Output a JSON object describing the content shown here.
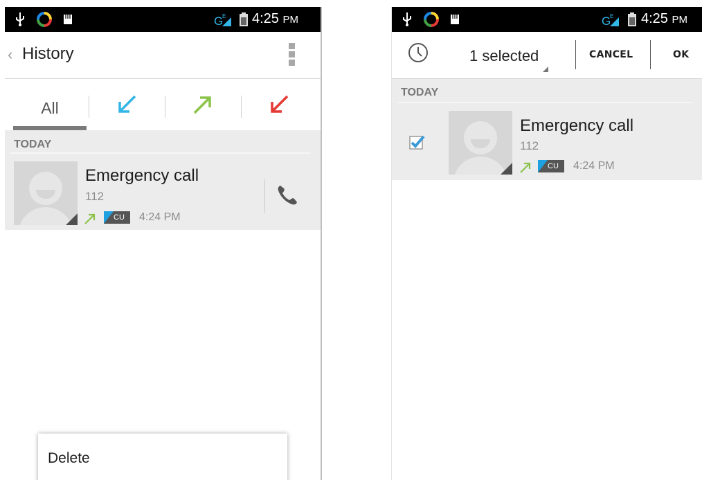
{
  "status_bar": {
    "time": "4:25",
    "ampm": "PM",
    "icons": [
      "usb-icon",
      "app-notification-icon",
      "sd-card-icon",
      "network-signal-icon",
      "battery-icon"
    ]
  },
  "left_screen": {
    "action_bar": {
      "back_icon": "‹",
      "title": "History",
      "overflow_icon": "overflow-menu-icon"
    },
    "tabs": [
      {
        "label": "All",
        "selected": true
      },
      {
        "icon": "incoming-call-icon",
        "color": "#33b5e5"
      },
      {
        "icon": "outgoing-call-icon",
        "color": "#8bc34a"
      },
      {
        "icon": "missed-call-icon",
        "color": "#e53935"
      }
    ],
    "section_header": "TODAY",
    "entry": {
      "name": "Emergency call",
      "number": "112",
      "call_type_icon": "outgoing-call-icon",
      "sim_label": "CU",
      "time": "4:24 PM",
      "call_icon": "phone-icon"
    },
    "popup_menu": {
      "items": [
        "Delete"
      ]
    }
  },
  "right_screen": {
    "action_bar": {
      "history_icon": "clock-icon",
      "selected_label": "1 selected",
      "cancel_label": "CANCEL",
      "ok_label": "OK"
    },
    "section_header": "TODAY",
    "entry": {
      "checked": true,
      "name": "Emergency call",
      "number": "112",
      "call_type_icon": "outgoing-call-icon",
      "sim_label": "CU",
      "time": "4:24 PM"
    }
  },
  "colors": {
    "incoming": "#33b5e5",
    "outgoing": "#8bc34a",
    "missed": "#e53935",
    "checkbox": "#3d9bd8",
    "sim_badge_accent": "#1fa0e0"
  }
}
